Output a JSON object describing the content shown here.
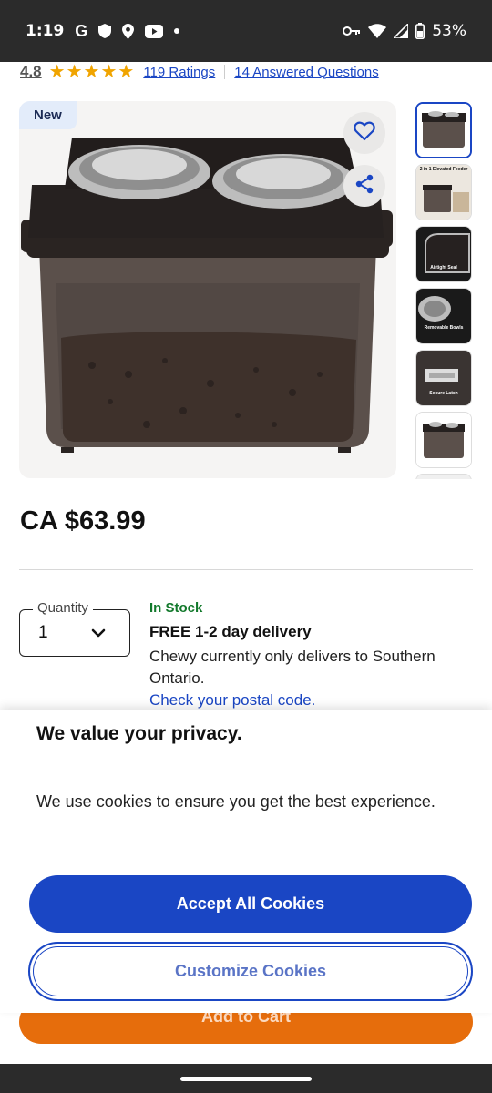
{
  "status_bar": {
    "time": "1:19",
    "g_icon": "G",
    "battery": "53%",
    "icons": [
      "shield-icon",
      "location-icon",
      "youtube-icon",
      "dot-icon",
      "vpn-key-icon",
      "wifi-icon",
      "signal-icon",
      "battery-icon"
    ]
  },
  "rating": {
    "value": "4.8",
    "stars": 5,
    "ratings_link": "119 Ratings",
    "questions_link": "14 Answered Questions"
  },
  "product_image": {
    "badge": "New",
    "icons": [
      "heart-icon",
      "share-icon"
    ]
  },
  "thumbnails": [
    {
      "caption": ""
    },
    {
      "caption": "2 in 1 Elevated Feeder"
    },
    {
      "caption": "Airtight Seal"
    },
    {
      "caption": "Removable Bowls"
    },
    {
      "caption": "Secure Latch"
    },
    {
      "caption": ""
    }
  ],
  "price": "CA $63.99",
  "quantity": {
    "label": "Quantity",
    "value": "1"
  },
  "delivery": {
    "stock": "In Stock",
    "title": "FREE 1-2 day delivery",
    "text": "Chewy currently only delivers to Southern Ontario.",
    "link": "Check your postal code."
  },
  "cookie": {
    "title": "We value your privacy.",
    "text": "We use cookies to ensure you get the best experience.",
    "accept": "Accept All Cookies",
    "customize": "Customize Cookies"
  },
  "cart": {
    "label": "Add to Cart"
  },
  "colors": {
    "accent_blue": "#1a46c4",
    "in_stock_green": "#13792c",
    "cart_orange": "#e66d0c",
    "star": "#f0a400"
  }
}
